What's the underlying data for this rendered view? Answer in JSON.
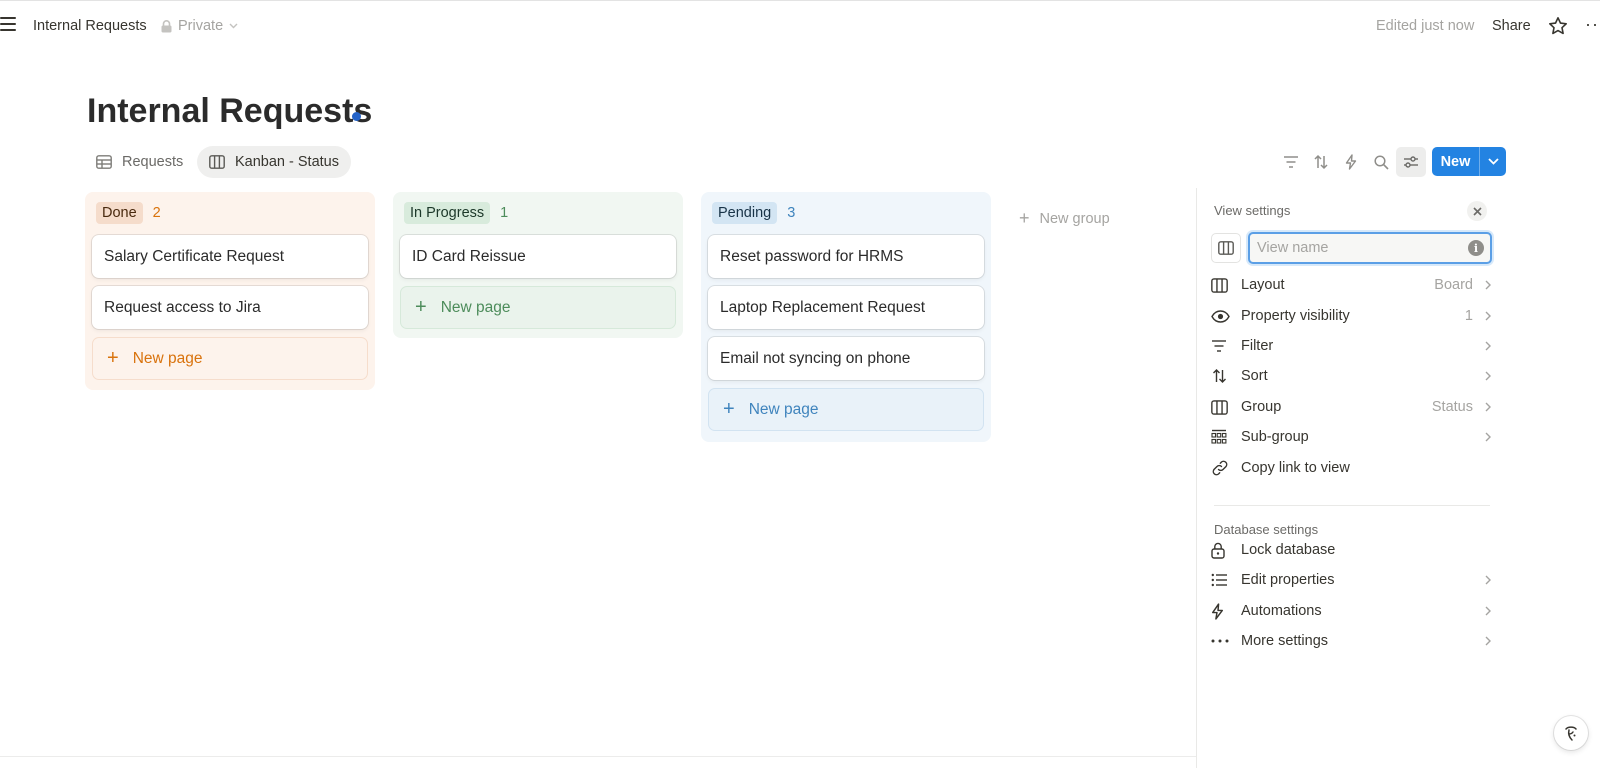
{
  "topbar": {
    "breadcrumb": "Internal Requests",
    "privacy": "Private",
    "edited": "Edited just now",
    "share": "Share",
    "menu_icon": "hamburger-icon",
    "star_icon": "star-icon",
    "more_icon": "more-horizontal-icon",
    "more_label": "··"
  },
  "page": {
    "title": "Internal Requests"
  },
  "views": {
    "tabs": [
      {
        "label": "Requests",
        "icon": "table-icon",
        "active": false
      },
      {
        "label": "Kanban - Status",
        "icon": "board-icon",
        "active": true
      }
    ]
  },
  "toolbar": {
    "tools": [
      "filter-icon",
      "sort-icon",
      "lightning-icon",
      "search-icon",
      "settings-sliders-icon"
    ],
    "new_label": "New",
    "accent": "#2383e2"
  },
  "board": {
    "columns": [
      {
        "name": "Done",
        "count": "2",
        "pill_bg": "#f5dccb",
        "pill_color": "#49290e",
        "count_color": "#d9730d",
        "cards": [
          "Salary Certificate Request",
          "Request access to Jira"
        ],
        "new_page": "New page"
      },
      {
        "name": "In Progress",
        "count": "1",
        "pill_bg": "#d8ebdc",
        "pill_color": "#1c3829",
        "count_color": "#4d8c5b",
        "cards": [
          "ID Card Reissue"
        ],
        "new_page": "New page"
      },
      {
        "name": "Pending",
        "count": "3",
        "pill_bg": "#d3e5f3",
        "pill_color": "#183347",
        "count_color": "#3f84bd",
        "cards": [
          "Reset password for HRMS",
          "Laptop Replacement Request",
          "Email not syncing on phone"
        ],
        "new_page": "New page"
      }
    ],
    "new_group": "New group"
  },
  "view_settings": {
    "title": "View settings",
    "view_name_placeholder": "View name",
    "items": [
      {
        "label": "Layout",
        "value": "Board",
        "icon": "board-icon",
        "chevron": true
      },
      {
        "label": "Property visibility",
        "value": "1",
        "icon": "eye-icon",
        "chevron": true
      },
      {
        "label": "Filter",
        "value": "",
        "icon": "filter-icon",
        "chevron": true
      },
      {
        "label": "Sort",
        "value": "",
        "icon": "sort-icon",
        "chevron": true
      },
      {
        "label": "Group",
        "value": "Status",
        "icon": "board-icon",
        "chevron": true
      },
      {
        "label": "Sub-group",
        "value": "",
        "icon": "subgroup-icon",
        "chevron": true
      },
      {
        "label": "Copy link to view",
        "value": "",
        "icon": "link-icon",
        "chevron": false
      }
    ],
    "database_title": "Database settings",
    "database_items": [
      {
        "label": "Lock database",
        "icon": "lock-icon",
        "chevron": false
      },
      {
        "label": "Edit properties",
        "icon": "list-icon",
        "chevron": true
      },
      {
        "label": "Automations",
        "icon": "lightning-icon",
        "chevron": true
      },
      {
        "label": "More settings",
        "icon": "more-horizontal-icon",
        "chevron": true
      }
    ]
  }
}
